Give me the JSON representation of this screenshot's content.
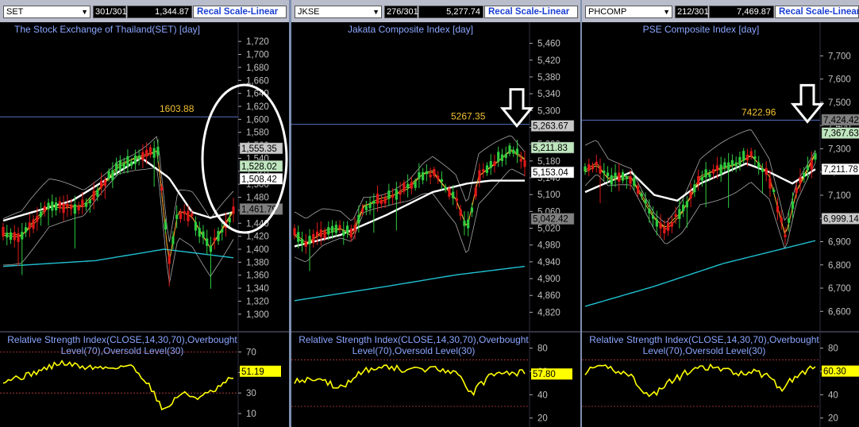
{
  "toolbar_label": "Recal Scale-Linear",
  "charts": [
    {
      "symbol": "SET",
      "count": "301/301",
      "last_value": "1,344.87",
      "title": "The Stock Exchange of Thailand(SET) [day]",
      "high_label": "1603.88",
      "price_axis": [
        "1,720",
        "1,700",
        "1,680",
        "1,660",
        "1,640",
        "1,620",
        "1,600",
        "1,580",
        "1,560",
        "1,540",
        "1,520",
        "1,500",
        "1,480",
        "1,460",
        "1,440",
        "1,420",
        "1,400",
        "1,380",
        "1,360",
        "1,340",
        "1,320",
        "1,300"
      ],
      "tags": [
        "1,555.35",
        "1,528.02",
        "1,508.42",
        "1,461.79"
      ],
      "rsi_title_1": "Relative Strength Index(CLOSE,14,30,70),Overbought",
      "rsi_title_2": "Level(70),Oversold Level(30)",
      "rsi_axis": [
        "70",
        "50",
        "30",
        "10"
      ],
      "rsi_value": "51.19"
    },
    {
      "symbol": "JKSE",
      "count": "276/301",
      "last_value": "5,277.74",
      "title": "Jakata Composite Index [day]",
      "high_label": "5267.35",
      "price_axis": [
        "5,460",
        "5,420",
        "5,380",
        "5,340",
        "5,300",
        "5,260",
        "5,220",
        "5,180",
        "5,140",
        "5,100",
        "5,060",
        "5,020",
        "4,980",
        "4,940",
        "4,900",
        "4,860",
        "4,820"
      ],
      "tags": [
        "5,263.67",
        "5,211.83",
        "5,153.04",
        "5,042.42"
      ],
      "rsi_title_1": "Relative Strength Index(CLOSE,14,30,70),Overbought",
      "rsi_title_2": "Level(70),Oversold Level(30)",
      "rsi_axis": [
        "80",
        "60",
        "40",
        "20"
      ],
      "rsi_value": "57.80"
    },
    {
      "symbol": "PHCOMP",
      "count": "212/301",
      "last_value": "7,469.87",
      "title": "PSE Composite Index [day]",
      "high_label": "7422.96",
      "price_axis": [
        "7,700",
        "7,600",
        "7,500",
        "7,400",
        "7,300",
        "7,200",
        "7,100",
        "7,000",
        "6,900",
        "6,800",
        "6,700",
        "6,600"
      ],
      "tags": [
        "7,424.42",
        "7,367.63",
        "7,211.78",
        "6,999.14"
      ],
      "rsi_title_1": "Relative Strength Index(CLOSE,14,30,70),Overbought",
      "rsi_title_2": "Level(70),Oversold Level(30)",
      "rsi_axis": [
        "80",
        "60",
        "40",
        "20"
      ],
      "rsi_value": "60.30"
    }
  ],
  "colors": {
    "background": "#000000",
    "up": "#2ecc40",
    "down": "#e01818",
    "bands": "#a8a8a8",
    "ma_long": "#ffffff",
    "ma_200": "#20c0d0",
    "rsi": "#ffff00",
    "tag_highlight": "#ffff00",
    "annotation": "#ffffff"
  },
  "chart_data": [
    {
      "type": "candlestick",
      "title": "The Stock Exchange of Thailand(SET) [day]",
      "ylim": [
        1290,
        1730
      ],
      "high": 1603.88,
      "last": {
        "upper_band": 1555.35,
        "close": 1528.02,
        "ma": 1508.42,
        "lower_band": 1461.79
      },
      "rsi": {
        "overbought": 70,
        "oversold": 30,
        "last": 51.19,
        "ylim": [
          0,
          85
        ]
      }
    },
    {
      "type": "candlestick",
      "title": "Jakata Composite Index [day]",
      "ylim": [
        4800,
        5480
      ],
      "high": 5267.35,
      "last": {
        "upper_band": 5263.67,
        "close": 5211.83,
        "ma": 5153.04,
        "lower_band": 5042.42
      },
      "rsi": {
        "overbought": 70,
        "oversold": 30,
        "last": 57.8,
        "ylim": [
          15,
          90
        ]
      }
    },
    {
      "type": "candlestick",
      "title": "PSE Composite Index [day]",
      "ylim": [
        6560,
        7790
      ],
      "high": 7422.96,
      "last": {
        "upper_band": 7424.42,
        "close": 7367.63,
        "ma": 7211.78,
        "lower_band": 6999.14
      },
      "rsi": {
        "overbought": 70,
        "oversold": 30,
        "last": 60.3,
        "ylim": [
          15,
          90
        ]
      }
    }
  ]
}
